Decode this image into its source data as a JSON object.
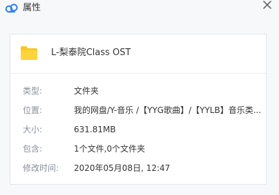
{
  "window": {
    "title": "属性",
    "app_icon": "cloud-logo-icon",
    "close_icon": "close-icon"
  },
  "item": {
    "icon": "folder-icon",
    "name": "L-梨泰院Class OST"
  },
  "properties": [
    {
      "label": "类型:",
      "value": "文件夹"
    },
    {
      "label": "位置:",
      "value": "我的网盘/Y-音乐 /【YYG歌曲】/【YYLB】音乐类..."
    },
    {
      "label": "大小:",
      "value": "631.81MB"
    },
    {
      "label": "包含:",
      "value": "1个文件,0个文件夹"
    },
    {
      "label": "修改时间:",
      "value": "2020年05月08日, 12:47"
    }
  ],
  "colors": {
    "background": "#f7f8fa",
    "panel": "#ffffff",
    "folder": "#f8c81e",
    "label_text": "#8a8f99",
    "value_text": "#333333",
    "logo_blue": "#2c7ef8"
  }
}
